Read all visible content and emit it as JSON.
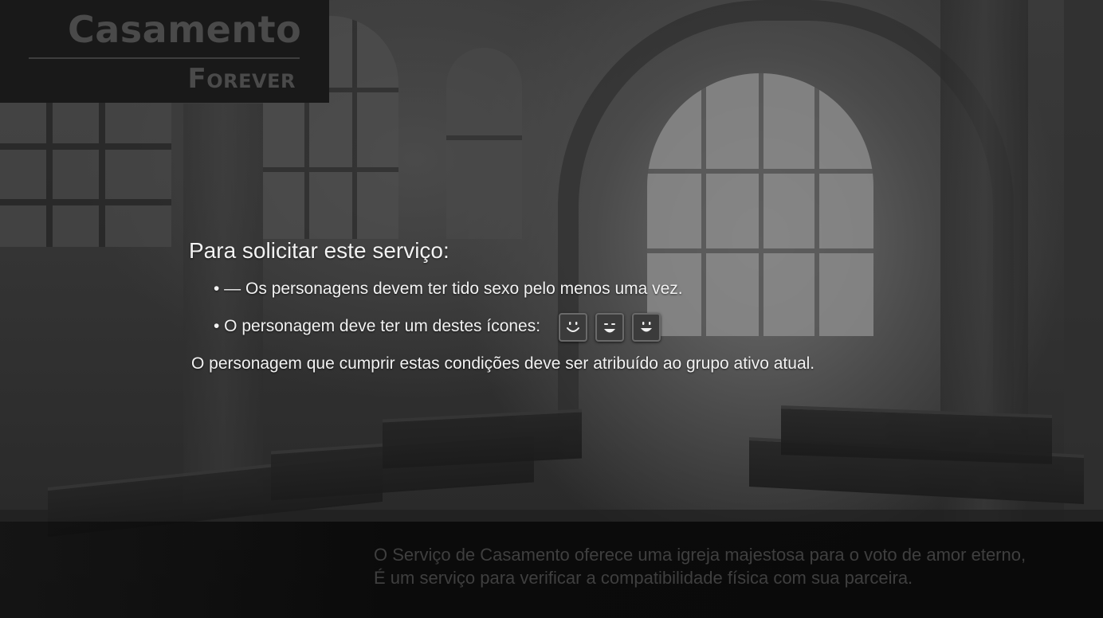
{
  "logo": {
    "title": "Casamento",
    "subtitle": "Forever"
  },
  "requirements": {
    "heading": "Para solicitar este serviço:",
    "bullet_1": "• — Os personagens devem ter tido sexo pelo menos uma vez.",
    "bullet_2": "• O personagem deve ter um destes ícones:",
    "note": "O personagem que cumprir estas condições deve ser atribuído ao grupo ativo atual.",
    "icons": [
      "smile-face-icon",
      "grin-face-icon",
      "happy-face-icon"
    ]
  },
  "description": {
    "line_1": "O Serviço de Casamento oferece uma igreja majestosa para o voto de amor eterno,",
    "line_2": "É um serviço para verificar a compatibilidade física com sua parceira."
  },
  "colors": {
    "text": "#f2f2f2",
    "logo_text": "#4a4a4a",
    "description_text": "#3f3f3f",
    "icon_bg": "#3b3b3b"
  }
}
